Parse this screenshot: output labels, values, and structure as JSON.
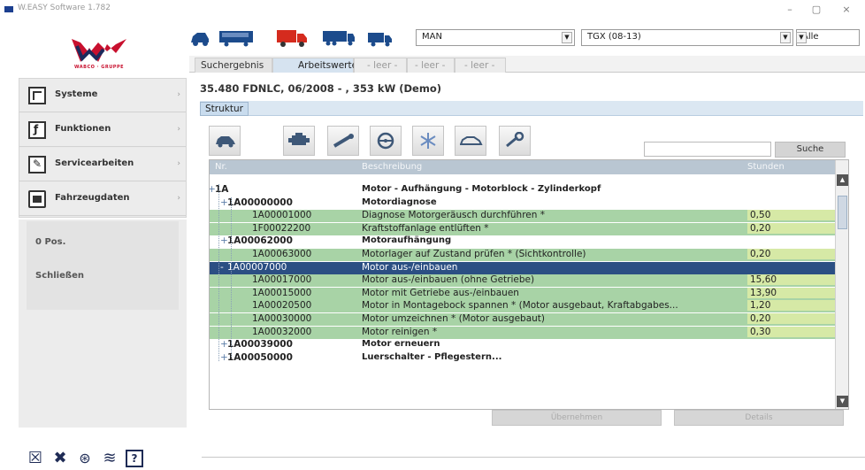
{
  "window": {
    "title": "W.EASY Software 1.782",
    "minimize_label": "–",
    "maximize_label": "▢",
    "close_label": "×"
  },
  "brand": {
    "logo_text": "WABCO · GRUPPE",
    "accent": "#c8102e",
    "dark_blue": "#1c2a5c"
  },
  "sidebar": {
    "items": [
      {
        "label": "Systeme",
        "icon": "document-icon"
      },
      {
        "label": "Funktionen",
        "icon": "function-icon"
      },
      {
        "label": "Servicearbeiten",
        "icon": "wrench-icon"
      },
      {
        "label": "Fahrzeugdaten",
        "icon": "folder-icon"
      }
    ],
    "positions_label": "0 Pos.",
    "close_label": "Schließen"
  },
  "bottom_icons": [
    "close-box-icon",
    "tools-icon",
    "settings-icon",
    "database-icon",
    "help-icon"
  ],
  "vehicle_bar": {
    "make": "MAN",
    "model": "TGX (08-13)",
    "filter": "Alle"
  },
  "tabs": [
    {
      "label": "Suchergebnis",
      "state": "normal"
    },
    {
      "label": "Arbeitswerte",
      "state": "active"
    },
    {
      "label": "- leer -",
      "state": "dim"
    },
    {
      "label": "- leer -",
      "state": "dim"
    },
    {
      "label": "- leer -",
      "state": "dim"
    }
  ],
  "vehicle_title": "35.480 FDNLC, 06/2008 - , 353 kW (Demo)",
  "structure_tab": "Struktur",
  "search": {
    "placeholder": "",
    "button_label": "Suche"
  },
  "table": {
    "headers": {
      "nr": "Nr.",
      "desc": "Beschreibung",
      "hours": "Stunden"
    },
    "rows": [
      {
        "type": "grp",
        "level": 0,
        "prefix": "+",
        "nr": "1A",
        "desc": "Motor - Aufhängung - Motorblock - Zylinderkopf",
        "hours": ""
      },
      {
        "type": "grp",
        "level": 1,
        "prefix": "+",
        "nr": "1A00000000",
        "desc": "Motordiagnose",
        "hours": ""
      },
      {
        "type": "op",
        "level": 2,
        "prefix": "",
        "nr": "1A00001000",
        "desc": "Diagnose Motorgeräusch durchführen *",
        "hours": "0,50"
      },
      {
        "type": "op",
        "level": 2,
        "prefix": "",
        "nr": "1F00022200",
        "desc": "Kraftstoffanlage entlüften *",
        "hours": "0,20"
      },
      {
        "type": "grp",
        "level": 1,
        "prefix": "+",
        "nr": "1A00062000",
        "desc": "Motoraufhängung",
        "hours": ""
      },
      {
        "type": "op",
        "level": 2,
        "prefix": "",
        "nr": "1A00063000",
        "desc": "Motorlager auf Zustand prüfen * (Sichtkontrolle)",
        "hours": "0,20"
      },
      {
        "type": "sel",
        "level": 1,
        "prefix": "-",
        "nr": "1A00007000",
        "desc": "Motor aus-/einbauen",
        "hours": ""
      },
      {
        "type": "op",
        "level": 2,
        "prefix": "",
        "nr": "1A00017000",
        "desc": "Motor aus-/einbauen (ohne Getriebe)",
        "hours": "15,60"
      },
      {
        "type": "op",
        "level": 2,
        "prefix": "",
        "nr": "1A00015000",
        "desc": "Motor mit Getriebe aus-/einbauen",
        "hours": "13,90"
      },
      {
        "type": "op",
        "level": 2,
        "prefix": "",
        "nr": "1A00020500",
        "desc": "Motor in Montagebock spannen * (Motor ausgebaut, Kraftabgabes...",
        "hours": "1,20"
      },
      {
        "type": "op",
        "level": 2,
        "prefix": "",
        "nr": "1A00030000",
        "desc": "Motor umzeichnen * (Motor ausgebaut)",
        "hours": "0,20"
      },
      {
        "type": "op",
        "level": 2,
        "prefix": "",
        "nr": "1A00032000",
        "desc": "Motor reinigen *",
        "hours": "0,30"
      },
      {
        "type": "grp",
        "level": 1,
        "prefix": "+",
        "nr": "1A00039000",
        "desc": "Motor erneuern",
        "hours": ""
      },
      {
        "type": "grp",
        "level": 1,
        "prefix": "+",
        "nr": "1A00050000",
        "desc": "Luerschalter - Pflegestern...",
        "hours": ""
      }
    ]
  },
  "bottom_buttons": {
    "left": "Übernehmen",
    "right": "Details"
  }
}
